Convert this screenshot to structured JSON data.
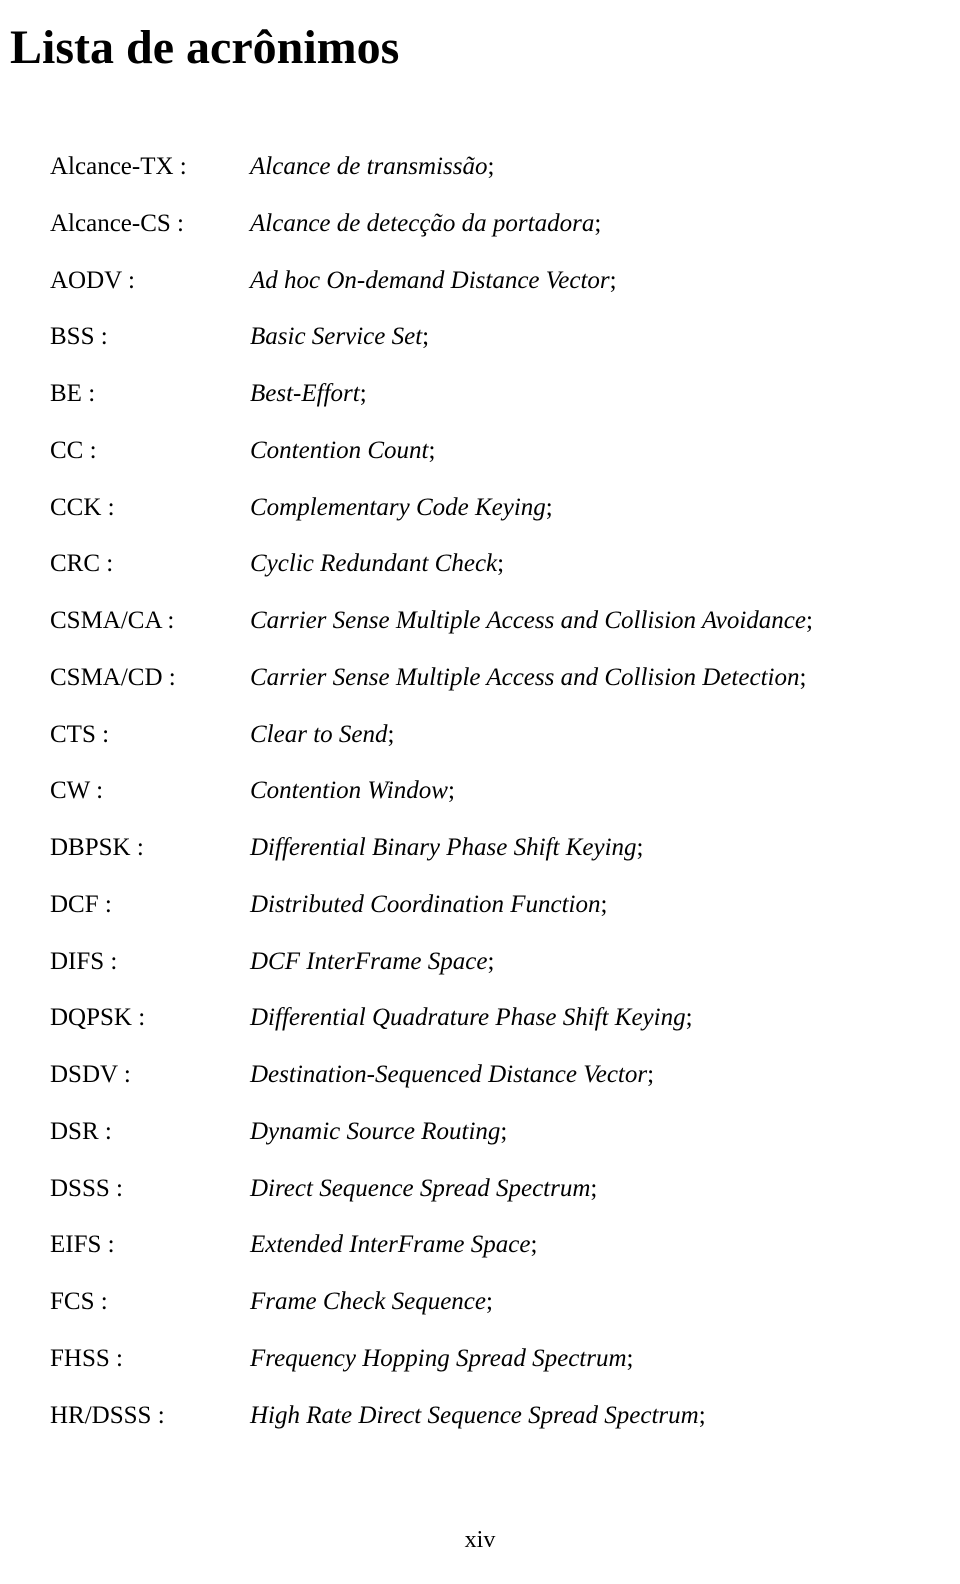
{
  "title": "Lista de acrônimos",
  "entries": [
    {
      "term": "Alcance-TX :",
      "definition": "Alcance de transmissão"
    },
    {
      "term": "Alcance-CS :",
      "definition": "Alcance de detecção da portadora"
    },
    {
      "term": "AODV :",
      "definition": "Ad hoc On-demand Distance Vector"
    },
    {
      "term": "BSS :",
      "definition": "Basic Service Set"
    },
    {
      "term": "BE :",
      "definition": "Best-Effort"
    },
    {
      "term": "CC :",
      "definition": "Contention Count"
    },
    {
      "term": "CCK :",
      "definition": "Complementary Code Keying"
    },
    {
      "term": "CRC :",
      "definition": "Cyclic Redundant Check"
    },
    {
      "term": "CSMA/CA :",
      "definition": "Carrier Sense Multiple Access and Collision Avoidance"
    },
    {
      "term": "CSMA/CD :",
      "definition": "Carrier Sense Multiple Access and Collision Detection"
    },
    {
      "term": "CTS :",
      "definition": "Clear to Send"
    },
    {
      "term": "CW :",
      "definition": "Contention Window"
    },
    {
      "term": "DBPSK :",
      "definition": "Differential Binary Phase Shift Keying"
    },
    {
      "term": "DCF :",
      "definition": "Distributed Coordination Function"
    },
    {
      "term": "DIFS :",
      "definition": "DCF InterFrame Space"
    },
    {
      "term": "DQPSK :",
      "definition": "Differential Quadrature Phase Shift Keying"
    },
    {
      "term": "DSDV :",
      "definition": "Destination-Sequenced Distance Vector"
    },
    {
      "term": "DSR :",
      "definition": "Dynamic Source Routing"
    },
    {
      "term": "DSSS :",
      "definition": "Direct Sequence Spread Spectrum"
    },
    {
      "term": "EIFS :",
      "definition": "Extended InterFrame Space"
    },
    {
      "term": "FCS :",
      "definition": "Frame Check Sequence"
    },
    {
      "term": "FHSS :",
      "definition": "Frequency Hopping Spread Spectrum"
    },
    {
      "term": "HR/DSSS :",
      "definition": "High Rate Direct Sequence Spread Spectrum"
    }
  ],
  "page_number": "xiv"
}
